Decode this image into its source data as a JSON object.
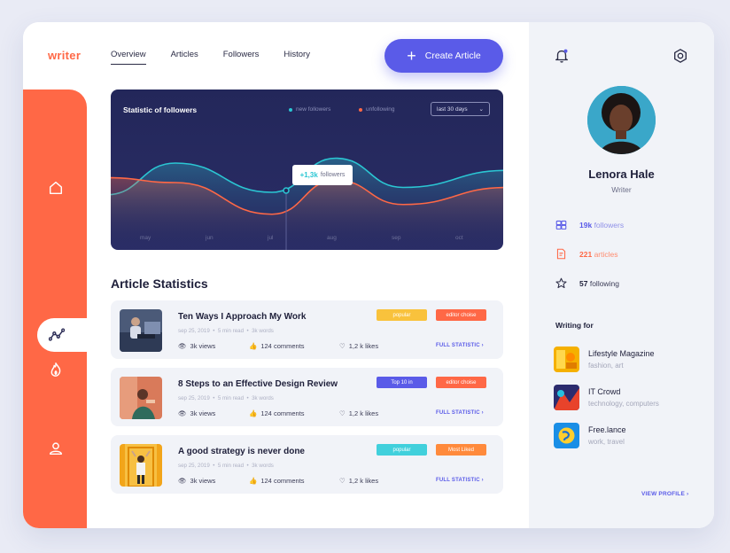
{
  "app": {
    "logo": "writer",
    "nav": [
      "Overview",
      "Articles",
      "Followers",
      "History"
    ],
    "create_button": "Create Article"
  },
  "rail": {
    "icons": [
      "home-icon",
      "trending-icon",
      "flame-icon",
      "user-icon"
    ],
    "active": "trending-icon"
  },
  "chart": {
    "title": "Statistic of followers",
    "legend_new": "new followers",
    "legend_unfollow": "unfollowing",
    "range": "last 30 days",
    "tooltip_value": "+1,3k",
    "tooltip_label": "followers",
    "months": [
      "may",
      "jun",
      "jul",
      "aug",
      "sep",
      "oct"
    ]
  },
  "chart_data": {
    "type": "area",
    "x": [
      "may",
      "jun",
      "jul",
      "aug",
      "sep",
      "oct"
    ],
    "series": [
      {
        "name": "new followers",
        "color": "#2bc6d3",
        "values": [
          35,
          48,
          36,
          50,
          38,
          45
        ]
      },
      {
        "name": "unfollowing",
        "color": "#ff6846",
        "values": [
          42,
          40,
          27,
          41,
          31,
          38
        ]
      }
    ],
    "highlight": {
      "x": "jul",
      "label": "+1,3k followers"
    },
    "grid": false,
    "legend_placement": "top-right"
  },
  "articles": {
    "section_title": "Article Statistics",
    "full_statistic_label": "FULL STATISTIC",
    "items": [
      {
        "title": "Ten Ways I Approach My Work",
        "date": "sep 25, 2019",
        "read": "5 min read",
        "words": "3k words",
        "views": "3k views",
        "comments": "124 comments",
        "likes": "1,2 k likes",
        "badges": [
          {
            "label": "popular",
            "color": "#f9c23c"
          },
          {
            "label": "editor choise",
            "color": "#ff6846"
          }
        ]
      },
      {
        "title": "8 Steps to an Effective Design Review",
        "date": "sep 25, 2019",
        "read": "5 min read",
        "words": "3k words",
        "views": "3k views",
        "comments": "124 comments",
        "likes": "1,2 k likes",
        "badges": [
          {
            "label": "Top 10 in",
            "color": "#5a5be8"
          },
          {
            "label": "editor choise",
            "color": "#ff6846"
          }
        ]
      },
      {
        "title": "A good strategy is never done",
        "date": "sep 25, 2019",
        "read": "5 min read",
        "words": "3k words",
        "views": "3k views",
        "comments": "124 comments",
        "likes": "1,2 k likes",
        "badges": [
          {
            "label": "popular",
            "color": "#41d0dc"
          },
          {
            "label": "Most Liked",
            "color": "#ff8a3c"
          }
        ]
      }
    ]
  },
  "profile": {
    "name": "Lenora Hale",
    "role": "Writer",
    "followers_num": "19k",
    "followers_label": "followers",
    "articles_num": "221",
    "articles_label": "articles",
    "following_num": "57",
    "following_label": "following",
    "writing_for_title": "Writing for",
    "publications": [
      {
        "name": "Lifestyle Magazine",
        "tags": "fashion, art"
      },
      {
        "name": "IT Crowd",
        "tags": "technology, computers"
      },
      {
        "name": "Free.lance",
        "tags": "work, travel"
      }
    ],
    "view_profile": "VIEW PROFILE"
  },
  "colors": {
    "accent": "#5a5be8",
    "brand": "#ff6846",
    "teal": "#2bc6d3",
    "chart_bg": "#23275a"
  }
}
